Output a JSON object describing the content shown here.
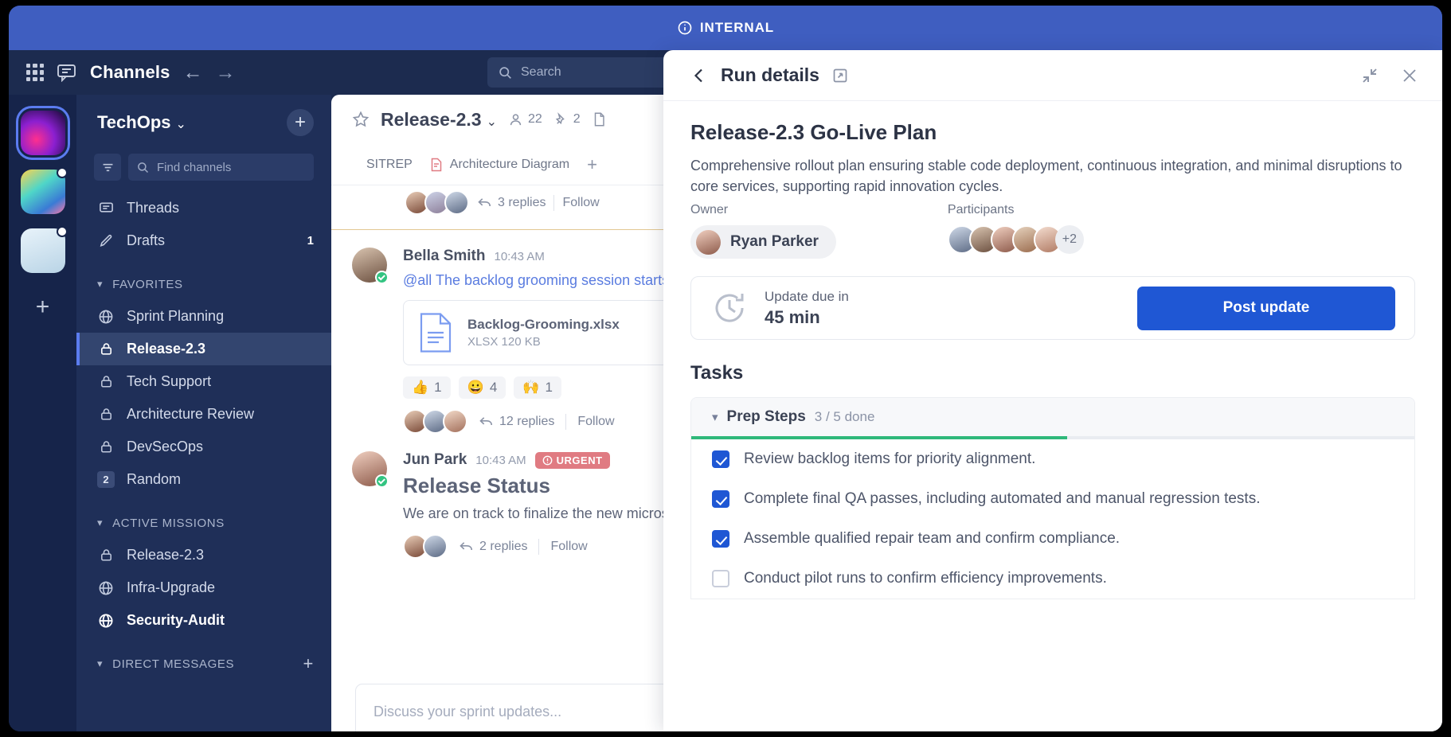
{
  "banner": {
    "label": "INTERNAL",
    "icon": "info-icon",
    "color": "#3f5ec0"
  },
  "global_nav": {
    "apps_icon": "grid-apps-icon",
    "chat_icon": "chat-bubble-icon",
    "title": "Channels",
    "back_icon": "arrow-left-icon",
    "forward_icon": "arrow-right-icon",
    "search_placeholder": "Search",
    "search_icon": "search-icon",
    "help_icon": "help-circle-icon",
    "mention_icon": "at-mention-icon",
    "saved_icon": "bookmark-icon",
    "settings_icon": "gear-icon",
    "avatar": "user-avatar"
  },
  "team_rail": {
    "teams": [
      "team-nebula",
      "team-aurora",
      "team-blueprint"
    ],
    "add_label": "+"
  },
  "sidebar": {
    "workspace": "TechOps",
    "chevron": "⌄",
    "add_label": "+",
    "filter_icon": "filter-icon",
    "find_placeholder": "Find channels",
    "find_icon": "search-icon",
    "top_items": [
      {
        "label": "Threads",
        "icon": "threads-icon",
        "count": ""
      },
      {
        "label": "Drafts",
        "icon": "pencil-icon",
        "count": "1"
      }
    ],
    "sections": [
      {
        "label": "FAVORITES",
        "items": [
          {
            "label": "Sprint Planning",
            "icon": "globe-icon",
            "state": ""
          },
          {
            "label": "Release-2.3",
            "icon": "lock-icon",
            "state": "active"
          },
          {
            "label": "Tech Support",
            "icon": "lock-icon",
            "state": ""
          },
          {
            "label": "Architecture Review",
            "icon": "lock-icon",
            "state": ""
          },
          {
            "label": "DevSecOps",
            "icon": "lock-icon",
            "state": ""
          },
          {
            "label": "Random",
            "icon": "badge-2",
            "state": ""
          }
        ]
      },
      {
        "label": "ACTIVE MISSIONS",
        "items": [
          {
            "label": "Release-2.3",
            "icon": "lock-icon",
            "state": ""
          },
          {
            "label": "Infra-Upgrade",
            "icon": "globe-icon",
            "state": ""
          },
          {
            "label": "Security-Audit",
            "icon": "globe-icon",
            "state": "bold"
          }
        ]
      },
      {
        "label": "DIRECT MESSAGES",
        "items": []
      }
    ]
  },
  "channel": {
    "star_icon": "star-icon",
    "name": "Release-2.3",
    "chevron": "⌄",
    "members_icon": "person-icon",
    "members": "22",
    "pins_icon": "pin-icon",
    "pins": "2",
    "files_icon": "file-icon",
    "tabs": [
      {
        "label": "SITREP",
        "icon": ""
      },
      {
        "label": "Architecture Diagram",
        "icon": "diagram-file-icon"
      }
    ],
    "add_tab": "+"
  },
  "messages": {
    "partial_top": {
      "replies": "3 replies",
      "follow": "Follow",
      "reply_icon": "reply-arrow-icon"
    },
    "items": [
      {
        "author": "Bella Smith",
        "time": "10:43 AM",
        "text": "@all The backlog grooming session starts in",
        "attachment": {
          "name": "Backlog-Grooming.xlsx",
          "meta": "XLSX 120 KB",
          "icon": "document-icon"
        },
        "reactions": [
          {
            "emoji": "👍",
            "count": "1"
          },
          {
            "emoji": "😀",
            "count": "4"
          },
          {
            "emoji": "🙌",
            "count": "1"
          }
        ],
        "replies": "12 replies",
        "follow": "Follow"
      },
      {
        "author": "Jun Park",
        "time": "10:43 AM",
        "badge": "URGENT",
        "badge_icon": "alert-circle-icon",
        "title": "Release Status",
        "text": "We are on track to finalize the new microse",
        "replies": "2 replies",
        "follow": "Follow"
      }
    ],
    "composer_placeholder": "Discuss your sprint updates..."
  },
  "panel": {
    "back_icon": "chevron-left-icon",
    "title": "Run details",
    "open_icon": "open-external-icon",
    "collapse_icon": "collapse-icon",
    "close_icon": "close-icon",
    "plan_title": "Release-2.3 Go-Live Plan",
    "plan_desc": "Comprehensive rollout plan ensuring stable code deployment, continuous integration, and minimal disruptions to core services, supporting rapid innovation cycles.",
    "owner_label": "Owner",
    "owner_name": "Ryan Parker",
    "participants_label": "Participants",
    "participants_overflow": "+2",
    "update_icon": "clock-refresh-icon",
    "update_label": "Update due in",
    "update_value": "45 min",
    "post_button": "Post update",
    "tasks_heading": "Tasks",
    "accent_color": "#1f57d4",
    "progress_color": "#2fb87a",
    "groups": [
      {
        "name": "Prep Steps",
        "count": "3 / 5 done",
        "progress_percent": 52,
        "chevron": "⌄",
        "items": [
          {
            "label": "Review backlog items for priority alignment.",
            "done": true
          },
          {
            "label": "Complete final QA passes, including automated and manual regression tests.",
            "done": true
          },
          {
            "label": "Assemble qualified repair team and confirm compliance.",
            "done": true
          },
          {
            "label": "Conduct pilot runs to confirm efficiency improvements.",
            "done": false
          }
        ]
      }
    ]
  }
}
